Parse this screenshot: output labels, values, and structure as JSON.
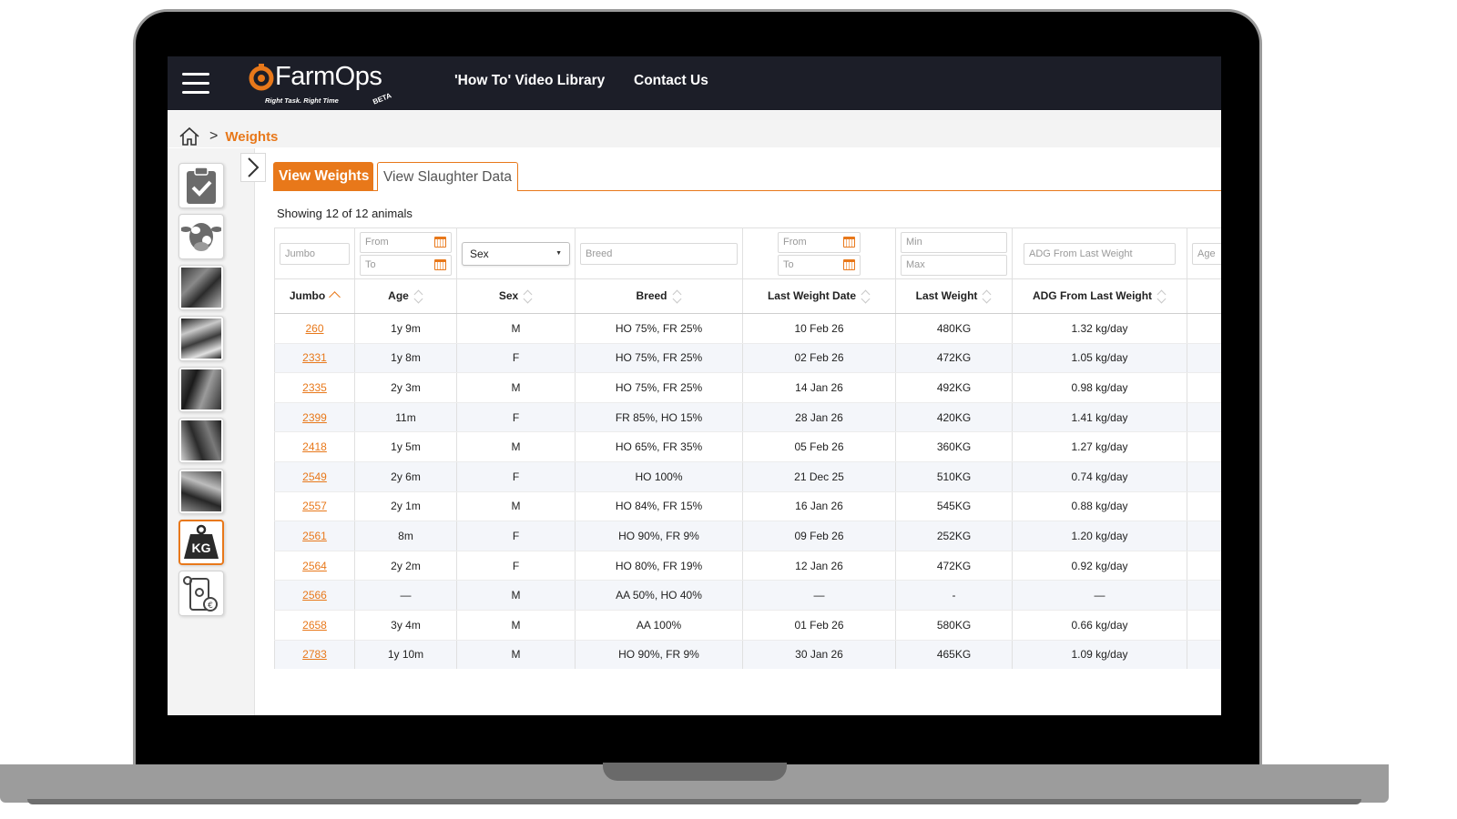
{
  "app": {
    "logo_text": "FarmOps",
    "tagline": "Right Task. Right Time",
    "beta": "BETA",
    "accent_color": "#e8781a",
    "topbar_color": "#1c1e28"
  },
  "nav": {
    "links": [
      "'How To' Video Library",
      "Contact Us"
    ]
  },
  "breadcrumb": {
    "separator": ">",
    "current": "Weights"
  },
  "sidebar": {
    "icons": [
      "clipboard-check-icon",
      "cow-icon",
      "photo",
      "photo",
      "photo",
      "photo",
      "photo",
      "kg-weight-icon",
      "phone-euro-icon"
    ],
    "kg_label": "KG"
  },
  "tabs": {
    "active": "View Weights",
    "inactive": "View Slaughter Data"
  },
  "summary": "Showing 12 of 12 animals",
  "filters": {
    "jumbo": "Jumbo",
    "age_from": "From",
    "age_to": "To",
    "sex": "Sex",
    "breed": "Breed",
    "date_from": "From",
    "date_to": "To",
    "weight_min": "Min",
    "weight_max": "Max",
    "adg": "ADG From Last Weight",
    "age_partial": "Age"
  },
  "columns": [
    "Jumbo",
    "Age",
    "Sex",
    "Breed",
    "Last Weight Date",
    "Last Weight",
    "ADG From Last Weight"
  ],
  "rows": [
    [
      "260",
      "1y 9m",
      "M",
      "HO 75%, FR 25%",
      "10 Feb 26",
      "480KG",
      "1.32 kg/day"
    ],
    [
      "2331",
      "1y 8m",
      "F",
      "HO 75%, FR 25%",
      "02 Feb 26",
      "472KG",
      "1.05 kg/day"
    ],
    [
      "2335",
      "2y 3m",
      "M",
      "HO 75%, FR 25%",
      "14 Jan 26",
      "492KG",
      "0.98 kg/day"
    ],
    [
      "2399",
      "11m",
      "F",
      "FR 85%, HO 15%",
      "28 Jan 26",
      "420KG",
      "1.41 kg/day"
    ],
    [
      "2418",
      "1y 5m",
      "M",
      "HO 65%, FR 35%",
      "05 Feb 26",
      "360KG",
      "1.27 kg/day"
    ],
    [
      "2549",
      "2y 6m",
      "F",
      "HO 100%",
      "21 Dec 25",
      "510KG",
      "0.74 kg/day"
    ],
    [
      "2557",
      "2y 1m",
      "M",
      "HO 84%, FR 15%",
      "16 Jan 26",
      "545KG",
      "0.88 kg/day"
    ],
    [
      "2561",
      "8m",
      "F",
      "HO 90%, FR 9%",
      "09 Feb 26",
      "252KG",
      "1.20 kg/day"
    ],
    [
      "2564",
      "2y 2m",
      "F",
      "HO 80%, FR 19%",
      "12 Jan 26",
      "472KG",
      "0.92 kg/day"
    ],
    [
      "2566",
      "—",
      "M",
      "AA 50%, HO 40%",
      "—",
      "-",
      "—"
    ],
    [
      "2658",
      "3y 4m",
      "M",
      "AA 100%",
      "01 Feb 26",
      "580KG",
      "0.66 kg/day"
    ],
    [
      "2783",
      "1y 10m",
      "M",
      "HO 90%, FR 9%",
      "30 Jan 26",
      "465KG",
      "1.09 kg/day"
    ]
  ]
}
